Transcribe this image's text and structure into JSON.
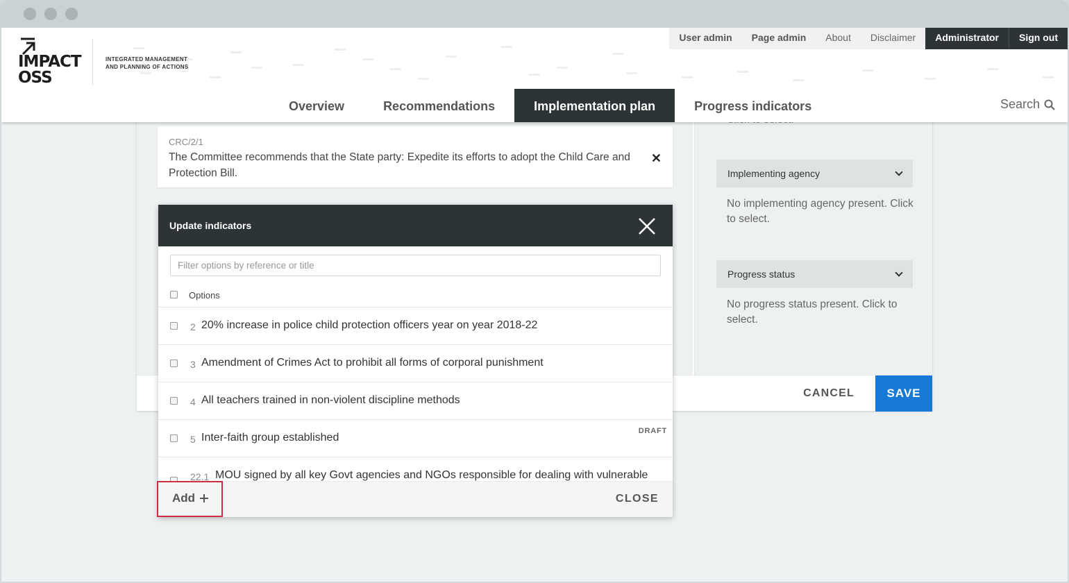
{
  "logo": {
    "line1": "IMPACT",
    "line2": "OSS",
    "tagline1": "INTEGRATED MANAGEMENT",
    "tagline2": "AND PLANNING OF ACTIONS"
  },
  "top_nav": [
    "User admin",
    "Page admin",
    "About",
    "Disclaimer",
    "Administrator",
    "Sign out"
  ],
  "main_nav": {
    "tabs": [
      "Overview",
      "Recommendations",
      "Implementation plan",
      "Progress indicators"
    ],
    "active": "Implementation plan"
  },
  "search_label": "Search",
  "recommendation": {
    "ref": "CRC/2/1",
    "text": "The Committee recommends that the State party: Expedite its efforts to adopt the Child Care and Protection Bill."
  },
  "right_panel": {
    "partial_hint": "Click to select.",
    "implementing_agency": {
      "label": "Implementing agency",
      "hint": "No implementing agency present. Click to select."
    },
    "progress_status": {
      "label": "Progress status",
      "hint": "No progress status present. Click to select."
    }
  },
  "footer": {
    "cancel": "CANCEL",
    "save": "SAVE"
  },
  "modal": {
    "title": "Update indicators",
    "filter_placeholder": "Filter options by reference or title",
    "options_header": "Options",
    "options": [
      {
        "num": "2",
        "text": "20% increase in police child protection officers year on year 2018-22",
        "badge": ""
      },
      {
        "num": "3",
        "text": "Amendment of Crimes Act to prohibit all forms of corporal punishment",
        "badge": ""
      },
      {
        "num": "4",
        "text": "All teachers trained in non-violent discipline methods",
        "badge": ""
      },
      {
        "num": "5",
        "text": "Inter-faith group established",
        "badge": "DRAFT"
      },
      {
        "num": "22.1",
        "text": "MOU signed by all key Govt agencies and NGOs responsible for dealing with vulnerable",
        "badge": ""
      }
    ],
    "add_label": "Add",
    "close_label": "CLOSE"
  },
  "colors": {
    "accent_dark": "#2c3436",
    "save_blue": "#1779d5",
    "highlight_red": "#cf2c43"
  }
}
